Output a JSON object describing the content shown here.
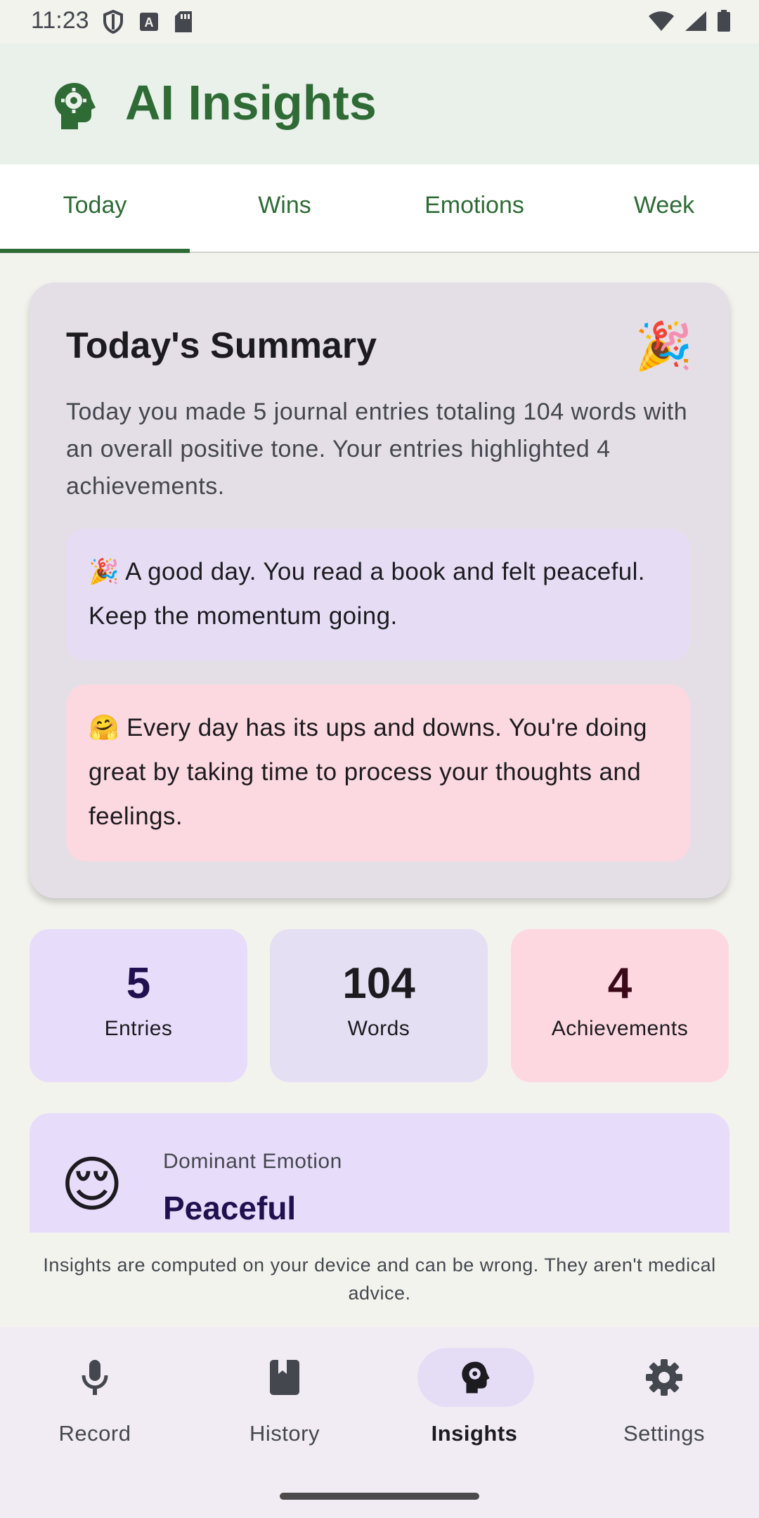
{
  "status_bar": {
    "time": "11:23",
    "icons_left": [
      "shield-icon",
      "font-icon",
      "sd-card-icon"
    ],
    "icons_right": [
      "wifi-icon",
      "signal-icon",
      "battery-icon"
    ]
  },
  "app_bar": {
    "title": "AI Insights",
    "icon": "brain-gear-icon",
    "accent_color": "#2e6b35"
  },
  "tabs": [
    {
      "label": "Today",
      "active": true
    },
    {
      "label": "Wins",
      "active": false
    },
    {
      "label": "Emotions",
      "active": false
    },
    {
      "label": "Week",
      "active": false
    }
  ],
  "summary": {
    "title": "Today's Summary",
    "emoji": "🎉",
    "text": "Today you made 5 journal entries totaling 104 words with an overall positive tone. Your entries highlighted 4 achievements.",
    "notes": [
      "🎉 A good day. You read a book and felt peaceful. Keep the momentum going.",
      "🤗 Every day has its ups and downs. You're doing great by taking time to process your thoughts and feelings."
    ]
  },
  "stats": [
    {
      "value": "5",
      "label": "Entries"
    },
    {
      "value": "104",
      "label": "Words"
    },
    {
      "value": "4",
      "label": "Achievements"
    }
  ],
  "emotion": {
    "label": "Dominant Emotion",
    "value": "Peaceful",
    "emoji": "😌"
  },
  "disclaimer": "Insights are computed on your device and can be wrong. They aren't medical advice.",
  "bottom_nav": [
    {
      "label": "Record",
      "icon": "microphone-icon",
      "active": false
    },
    {
      "label": "History",
      "icon": "book-icon",
      "active": false
    },
    {
      "label": "Insights",
      "icon": "brain-gear-icon",
      "active": true
    },
    {
      "label": "Settings",
      "icon": "gear-icon",
      "active": false
    }
  ]
}
